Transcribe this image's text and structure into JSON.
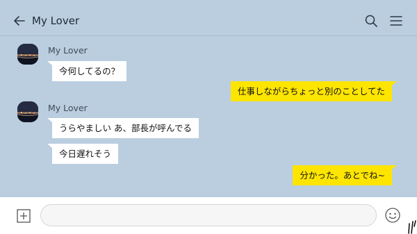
{
  "header": {
    "title": "My Lover",
    "back_icon": "back-arrow-icon",
    "search_icon": "search-icon",
    "menu_icon": "menu-icon"
  },
  "messages": [
    {
      "direction": "in",
      "sender": "My Lover",
      "text": "今何してるの？"
    },
    {
      "direction": "out",
      "text": "仕事しながらちょっと別のことしてた"
    },
    {
      "direction": "in",
      "sender": "My Lover",
      "text": "うらやましい あ、部長が呼んでる"
    },
    {
      "direction": "in",
      "text": "今日遅れそう"
    },
    {
      "direction": "out",
      "text": "分かった。あとでね~"
    }
  ],
  "input_bar": {
    "plus_icon": "plus-square-icon",
    "input_value": "",
    "emoji_icon": "emoji-icon"
  },
  "colors": {
    "background": "#bacee0",
    "outgoing_bubble": "#fee500",
    "incoming_bubble": "#ffffff"
  }
}
